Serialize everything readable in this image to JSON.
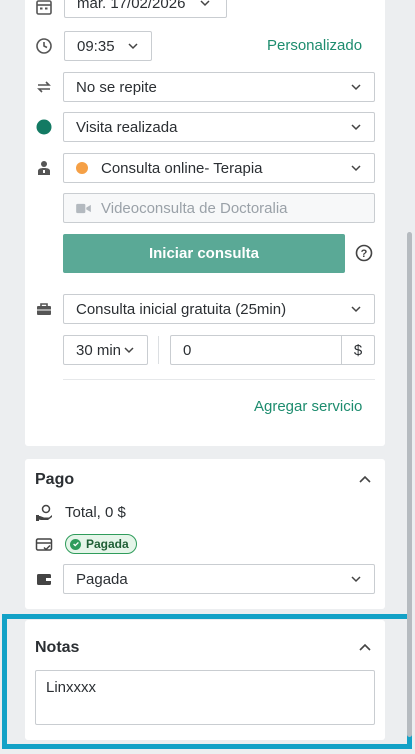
{
  "schedule": {
    "date": "mar. 17/02/2026",
    "time": "09:35",
    "custom_link": "Personalizado",
    "repeat": "No se repite",
    "status": "Visita realizada",
    "status_color": "#137a63",
    "service_location": "Consulta online- Terapia",
    "service_dot_color": "#f5a046",
    "video_placeholder": "Videoconsulta de Doctoralia",
    "start_button": "Iniciar consulta",
    "help_icon": "?",
    "service": "Consulta inicial gratuita (25min)",
    "duration": "30 min",
    "price": "0",
    "currency": "$",
    "add_service_link": "Agregar servicio"
  },
  "pago": {
    "title": "Pago",
    "total": "Total, 0 $",
    "badge": "Pagada",
    "method": "Pagada"
  },
  "notas": {
    "title": "Notas",
    "content": "Linxxxx"
  },
  "colors": {
    "accent": "#1d8c6e",
    "button": "#5aa996",
    "highlight": "#13a2c7"
  }
}
